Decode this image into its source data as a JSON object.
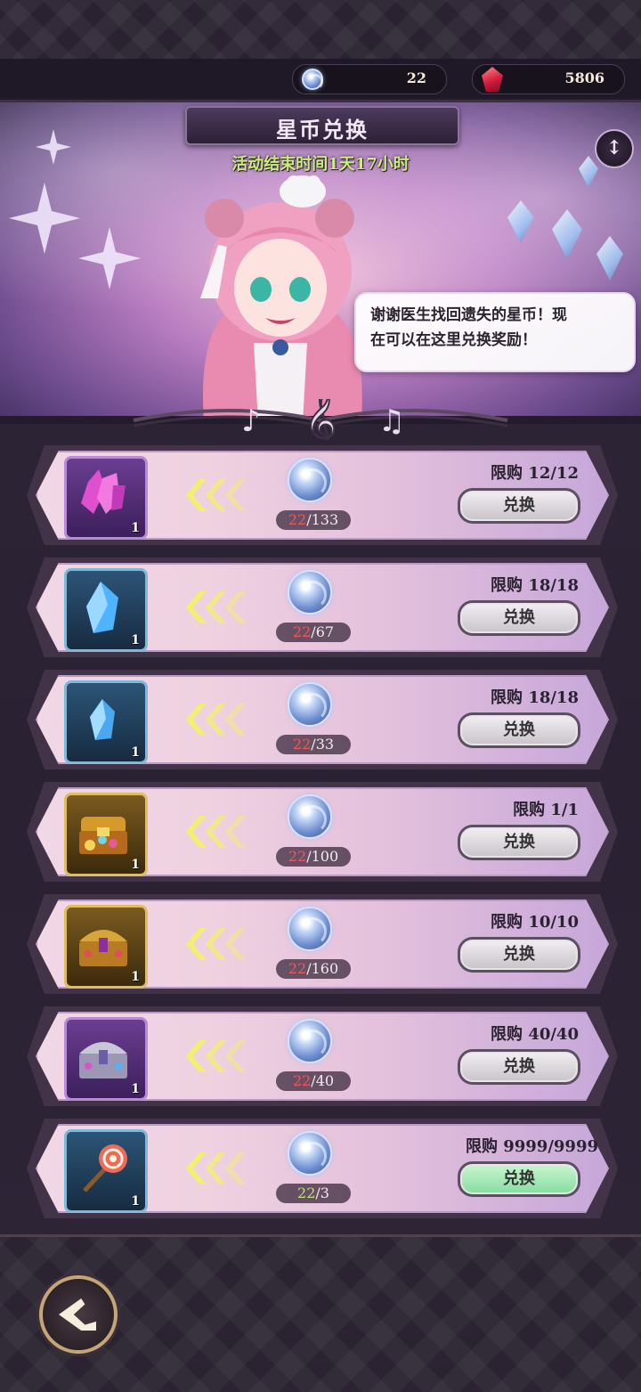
{
  "currency": {
    "star_coin_icon": "star-coin-icon",
    "star_coin_amount": "22",
    "gem_icon": "red-gem-icon",
    "gem_amount": "5806"
  },
  "header": {
    "title": "星币兑换",
    "end_time": "活动结束时间1天17小时",
    "info_icon": "info-icon"
  },
  "dialogue": {
    "line1": "谢谢医生找回遗失的星币！现",
    "line2": "在可以在这里兑换奖励！"
  },
  "items": [
    {
      "icon": "purple-crystal-icon",
      "count": "1",
      "have": "22",
      "need": "/133",
      "limit": "限购 12/12",
      "button": "兑换"
    },
    {
      "icon": "blue-crystal-icon",
      "count": "1",
      "have": "22",
      "need": "/67",
      "limit": "限购 18/18",
      "button": "兑换"
    },
    {
      "icon": "blue-crystal-small-icon",
      "count": "1",
      "have": "22",
      "need": "/33",
      "limit": "限购 18/18",
      "button": "兑换"
    },
    {
      "icon": "treasure-pile-icon",
      "count": "1",
      "have": "22",
      "need": "/100",
      "limit": "限购 1/1",
      "button": "兑换"
    },
    {
      "icon": "gold-chest-icon",
      "count": "1",
      "have": "22",
      "need": "/160",
      "limit": "限购 10/10",
      "button": "兑换"
    },
    {
      "icon": "silver-chest-icon",
      "count": "1",
      "have": "22",
      "need": "/40",
      "limit": "限购 40/40",
      "button": "兑换"
    },
    {
      "icon": "lollipop-icon",
      "count": "1",
      "have": "22",
      "need": "/3",
      "limit": "限购 9999/9999",
      "button": "兑换"
    }
  ],
  "colors": {
    "insufficient": "#f05858",
    "sufficient": "#b9e46b",
    "active_button": "#86dca1"
  },
  "footer": {
    "back_icon": "back-arrow-icon"
  }
}
